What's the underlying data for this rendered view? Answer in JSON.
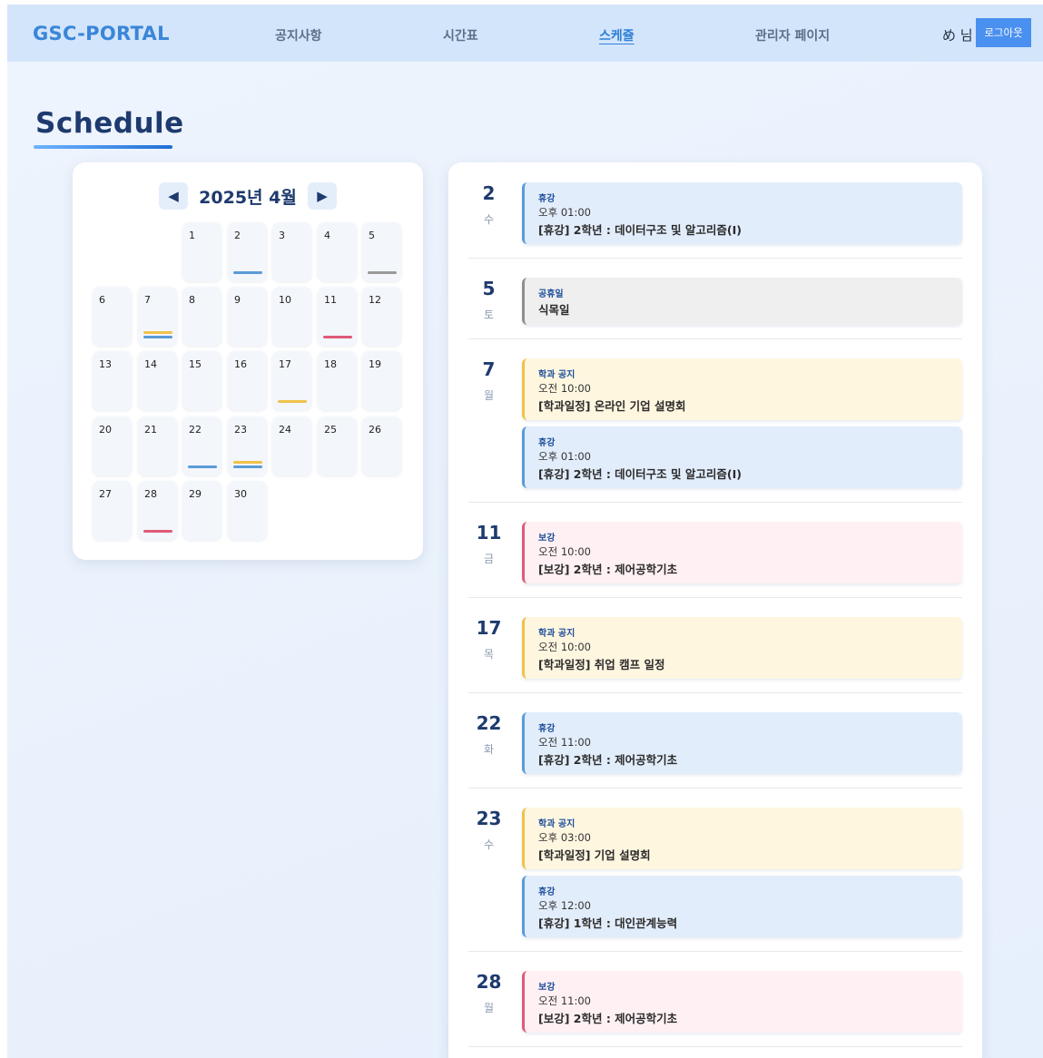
{
  "header": {
    "logo": "GSC-PORTAL",
    "nav": [
      "공지사항",
      "시간표",
      "스케쥴",
      "관리자 페이지"
    ],
    "active_nav": "스케쥴",
    "user": "め 님",
    "logout_label": "로그아웃"
  },
  "page_title": "Schedule",
  "calendar": {
    "month_label": "2025년 4월",
    "prev_icon": "◀",
    "next_icon": "▶",
    "days": [
      "1",
      "2",
      "3",
      "4",
      "5",
      "6",
      "7",
      "8",
      "9",
      "10",
      "11",
      "12",
      "13",
      "14",
      "15",
      "16",
      "17",
      "18",
      "19",
      "20",
      "21",
      "22",
      "23",
      "24",
      "25",
      "26",
      "27",
      "28",
      "29",
      "30"
    ],
    "markers": {
      "2": [
        "blue"
      ],
      "5": [
        "gray"
      ],
      "7": [
        "yellow",
        "blue"
      ],
      "11": [
        "pink"
      ],
      "17": [
        "yellow"
      ],
      "22": [
        "blue"
      ],
      "23": [
        "yellow",
        "blue"
      ],
      "28": [
        "pink"
      ]
    }
  },
  "colors": {
    "blue": "#5a9bd8",
    "gray": "#9a9a9a",
    "yellow": "#f0c24a",
    "pink": "#df5a78"
  },
  "schedule": [
    {
      "day": "2",
      "dow": "수",
      "events": [
        {
          "type": "blue",
          "category": "휴강",
          "time": "오후 01:00",
          "title": "[휴강] 2학년 : 데이터구조 및 알고리즘(I)"
        }
      ]
    },
    {
      "day": "5",
      "dow": "토",
      "events": [
        {
          "type": "gray",
          "category": "공휴일",
          "time": "",
          "title": "식목일"
        }
      ]
    },
    {
      "day": "7",
      "dow": "월",
      "events": [
        {
          "type": "yellow",
          "category": "학과 공지",
          "time": "오전 10:00",
          "title": "[학과일정] 온라인 기업 설명회"
        },
        {
          "type": "blue",
          "category": "휴강",
          "time": "오후 01:00",
          "title": "[휴강] 2학년 : 데이터구조 및 알고리즘(I)"
        }
      ]
    },
    {
      "day": "11",
      "dow": "금",
      "events": [
        {
          "type": "pink",
          "category": "보강",
          "time": "오전 10:00",
          "title": "[보강] 2학년 : 제어공학기초"
        }
      ]
    },
    {
      "day": "17",
      "dow": "목",
      "events": [
        {
          "type": "yellow",
          "category": "학과 공지",
          "time": "오전 10:00",
          "title": "[학과일정] 취업 캠프 일정"
        }
      ]
    },
    {
      "day": "22",
      "dow": "화",
      "events": [
        {
          "type": "blue",
          "category": "휴강",
          "time": "오전 11:00",
          "title": "[휴강] 2학년 : 제어공학기초"
        }
      ]
    },
    {
      "day": "23",
      "dow": "수",
      "events": [
        {
          "type": "yellow",
          "category": "학과 공지",
          "time": "오후 03:00",
          "title": "[학과일정] 기업 설명회"
        },
        {
          "type": "blue",
          "category": "휴강",
          "time": "오후 12:00",
          "title": "[휴강] 1학년 : 대인관계능력"
        }
      ]
    },
    {
      "day": "28",
      "dow": "월",
      "events": [
        {
          "type": "pink",
          "category": "보강",
          "time": "오전 11:00",
          "title": "[보강] 2학년 : 제어공학기초"
        }
      ]
    }
  ]
}
